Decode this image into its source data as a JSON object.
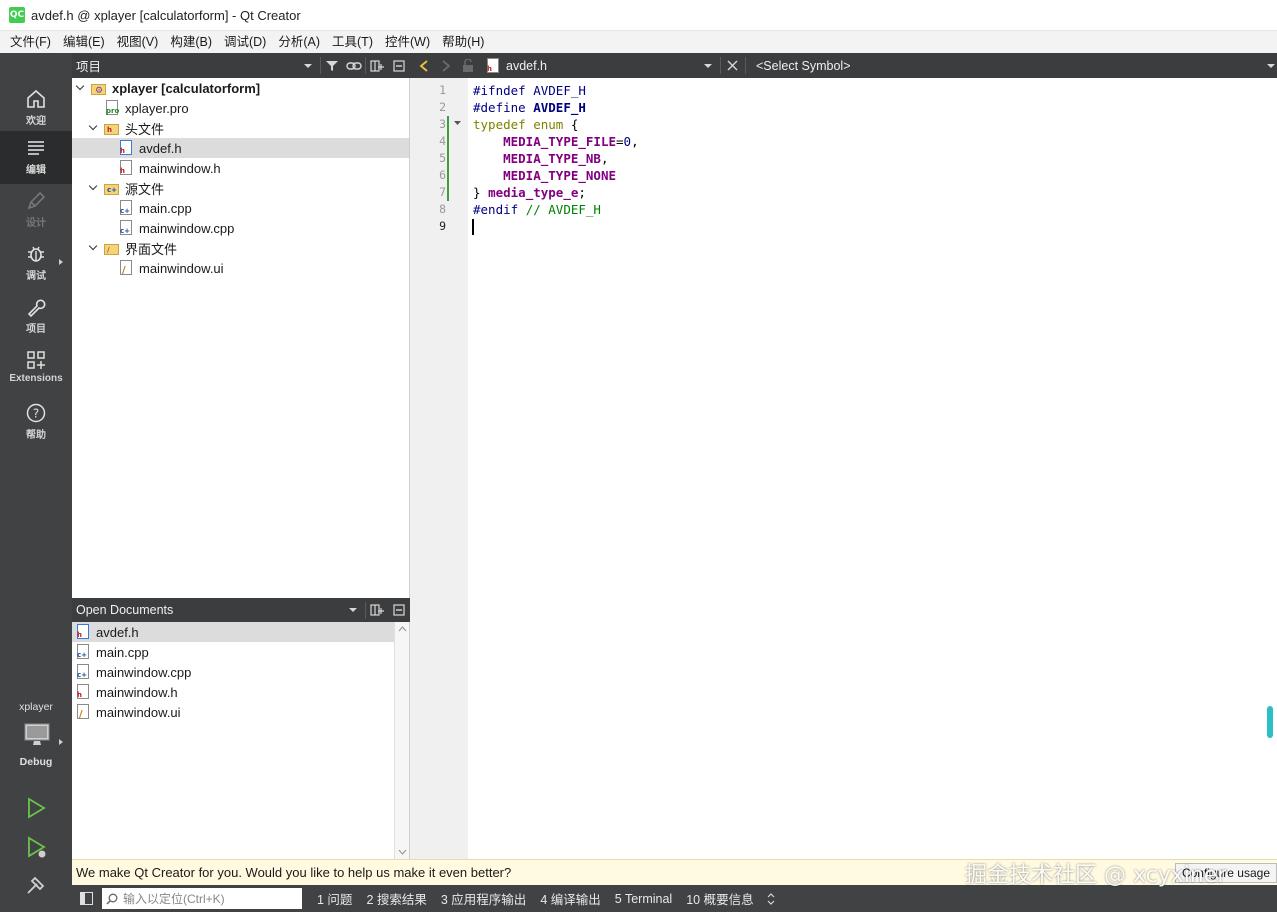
{
  "window": {
    "title": "avdef.h @ xplayer [calculatorform] - Qt Creator",
    "logo_text": "QC"
  },
  "menu": [
    "文件(F)",
    "编辑(E)",
    "视图(V)",
    "构建(B)",
    "调试(D)",
    "分析(A)",
    "工具(T)",
    "控件(W)",
    "帮助(H)"
  ],
  "modes": [
    {
      "label": "欢迎",
      "icon": "home-icon"
    },
    {
      "label": "编辑",
      "icon": "edit-lines-icon",
      "active": true
    },
    {
      "label": "设计",
      "icon": "pen-icon",
      "disabled": true
    },
    {
      "label": "调试",
      "icon": "bug-icon"
    },
    {
      "label": "项目",
      "icon": "wrench-icon"
    },
    {
      "label": "Extensions",
      "icon": "extensions-icon"
    },
    {
      "label": "帮助",
      "icon": "help-icon"
    }
  ],
  "kit": {
    "project": "xplayer",
    "config": "Debug"
  },
  "project_panel": {
    "title": "项目",
    "tree": [
      {
        "label": "xplayer [calculatorform]",
        "type": "project",
        "bold": true
      },
      {
        "label": "xplayer.pro",
        "type": "pro"
      },
      {
        "label": "头文件",
        "type": "folder",
        "tag": "h"
      },
      {
        "label": "avdef.h",
        "type": "h",
        "selected": true
      },
      {
        "label": "mainwindow.h",
        "type": "h"
      },
      {
        "label": "源文件",
        "type": "folder",
        "tag": "c"
      },
      {
        "label": "main.cpp",
        "type": "cpp"
      },
      {
        "label": "mainwindow.cpp",
        "type": "cpp"
      },
      {
        "label": "界面文件",
        "type": "folder",
        "tag": "ui"
      },
      {
        "label": "mainwindow.ui",
        "type": "ui"
      }
    ]
  },
  "open_documents": {
    "title": "Open Documents",
    "items": [
      {
        "label": "avdef.h",
        "type": "h",
        "selected": true
      },
      {
        "label": "main.cpp",
        "type": "cpp"
      },
      {
        "label": "mainwindow.cpp",
        "type": "cpp"
      },
      {
        "label": "mainwindow.h",
        "type": "h"
      },
      {
        "label": "mainwindow.ui",
        "type": "ui"
      }
    ]
  },
  "editor": {
    "file_name": "avdef.h",
    "symbol": "<Select Symbol>",
    "line_numbers": [
      "1",
      "2",
      "3",
      "4",
      "5",
      "6",
      "7",
      "8",
      "9"
    ],
    "current_line": 9,
    "code": {
      "l1_pp": "#ifndef",
      "l1_mac": "AVDEF_H",
      "l2_pp": "#define",
      "l2_mac": "AVDEF_H",
      "l3_kw": "typedef enum",
      "l3_rest": "{",
      "l4_en": "MEDIA_TYPE_FILE",
      "l4_eq": "=",
      "l4_num": "0",
      "l4_comma": ",",
      "l5_en": "MEDIA_TYPE_NB",
      "l5_comma": ",",
      "l6_en": "MEDIA_TYPE_NONE",
      "l7_brace": "}",
      "l7_id": "media_type_e",
      "l7_semi": ";",
      "l8_pp": "#endif",
      "l8_cm": "// AVDEF_H"
    }
  },
  "infobar": {
    "text": "We make Qt Creator for you. Would you like to help us make it even better?",
    "button": "Configure usage"
  },
  "outputbar": {
    "locator_placeholder": "输入以定位(Ctrl+K)",
    "tabs": [
      "1  问题",
      "2  搜索结果",
      "3  应用程序输出",
      "4  编译输出",
      "5  Terminal",
      "10  概要信息"
    ]
  },
  "watermark": "掘金技术社区 @ xcyxiner"
}
